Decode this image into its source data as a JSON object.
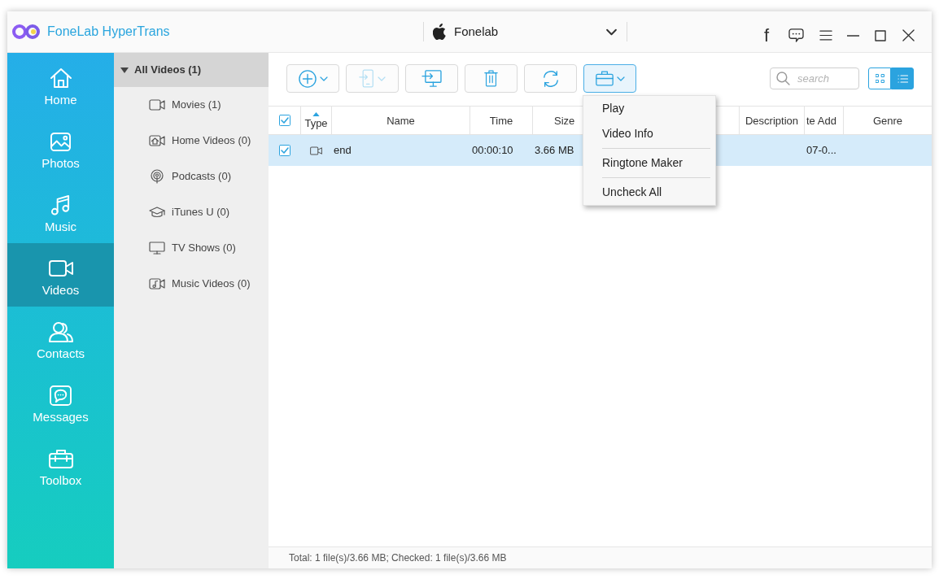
{
  "app": {
    "title": "FoneLab HyperTrans"
  },
  "device_selector": {
    "device": "Fonelab"
  },
  "title_bar": {
    "social_button": "f"
  },
  "sidebar": {
    "items": [
      {
        "label": "Home",
        "selected": false
      },
      {
        "label": "Photos",
        "selected": false
      },
      {
        "label": "Music",
        "selected": false
      },
      {
        "label": "Videos",
        "selected": true
      },
      {
        "label": "Contacts",
        "selected": false
      },
      {
        "label": "Messages",
        "selected": false
      },
      {
        "label": "Toolbox",
        "selected": false
      }
    ]
  },
  "categories": {
    "header": {
      "label": "All Videos (1)",
      "expanded": true
    },
    "items": [
      {
        "label": "Movies (1)"
      },
      {
        "label": "Home Videos (0)"
      },
      {
        "label": "Podcasts (0)"
      },
      {
        "label": "iTunes U (0)"
      },
      {
        "label": "TV Shows (0)"
      },
      {
        "label": "Music Videos (0)"
      }
    ]
  },
  "toolbar": {
    "buttons": [
      {
        "disabled": false,
        "expanded": false
      },
      {
        "disabled": true,
        "expanded": false
      },
      {
        "disabled": false,
        "expanded": false
      },
      {
        "disabled": false,
        "expanded": false
      },
      {
        "disabled": false,
        "expanded": false
      },
      {
        "disabled": false,
        "expanded": true
      }
    ],
    "search": {
      "placeholder": "search"
    },
    "view_toggle": [
      {
        "selected": false
      },
      {
        "selected": true
      }
    ]
  },
  "table": {
    "select_all_checked": true,
    "columns": [
      {
        "label": "Type",
        "sorted": true
      },
      {
        "label": "Name",
        "sorted": false
      },
      {
        "label": "Time",
        "sorted": false
      },
      {
        "label": "Size",
        "sorted": false
      },
      {
        "label": "Description",
        "sorted": false
      },
      {
        "label": "te Add",
        "sorted": false
      },
      {
        "label": "Genre",
        "sorted": false
      }
    ],
    "rows": [
      {
        "checked": true,
        "selected": true,
        "name": "end",
        "time": "00:00:10",
        "size": "3.66 MB",
        "column_6": "07-0..."
      }
    ]
  },
  "menu": {
    "groups": [
      [
        "Play",
        "Video Info"
      ],
      [
        "Ringtone Maker"
      ],
      [
        "Uncheck All"
      ]
    ]
  },
  "status_bar": {
    "text": "Total: 1 file(s)/3.66 MB; Checked: 1 file(s)/3.66 MB"
  }
}
